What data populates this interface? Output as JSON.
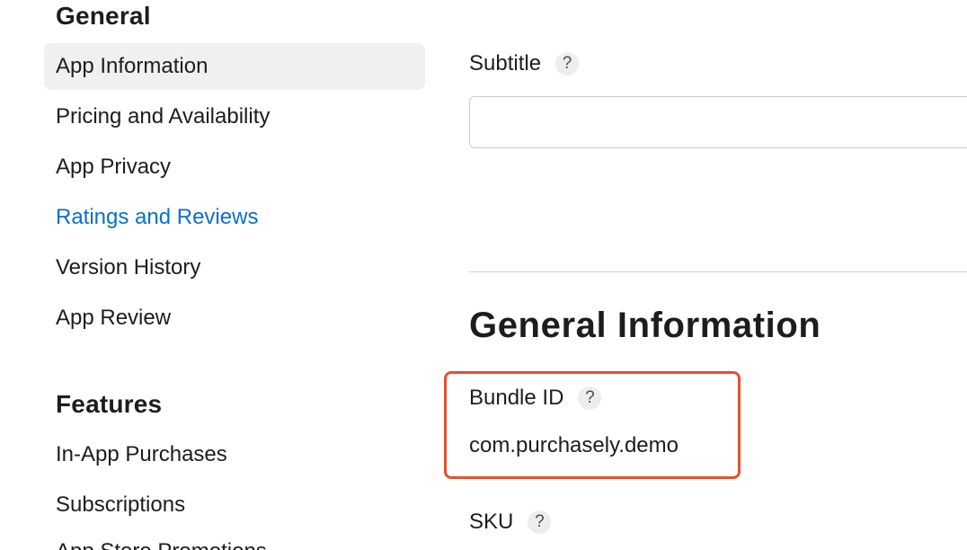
{
  "sidebar": {
    "general_title": "General",
    "general_items": [
      {
        "label": "App Information",
        "state": "selected"
      },
      {
        "label": "Pricing and Availability"
      },
      {
        "label": "App Privacy"
      },
      {
        "label": "Ratings and Reviews",
        "state": "link"
      },
      {
        "label": "Version History"
      },
      {
        "label": "App Review"
      }
    ],
    "features_title": "Features",
    "features_items": [
      {
        "label": "In-App Purchases"
      },
      {
        "label": "Subscriptions"
      },
      {
        "label": "App Store Promotions"
      }
    ]
  },
  "main": {
    "subtitle": {
      "label": "Subtitle",
      "help_icon": "?",
      "value": "",
      "placeholder": ""
    },
    "general_information": {
      "heading": "General Information",
      "bundle_id": {
        "label": "Bundle ID",
        "help_icon": "?",
        "value": "com.purchasely.demo"
      },
      "sku": {
        "label": "SKU",
        "help_icon": "?"
      }
    }
  },
  "colors": {
    "link": "#0a70c9",
    "selected_bg": "#f0f0f2",
    "highlight_border": "#e5512f",
    "text": "#1d1d1f"
  },
  "icons": {
    "help": "question-circle-icon"
  }
}
